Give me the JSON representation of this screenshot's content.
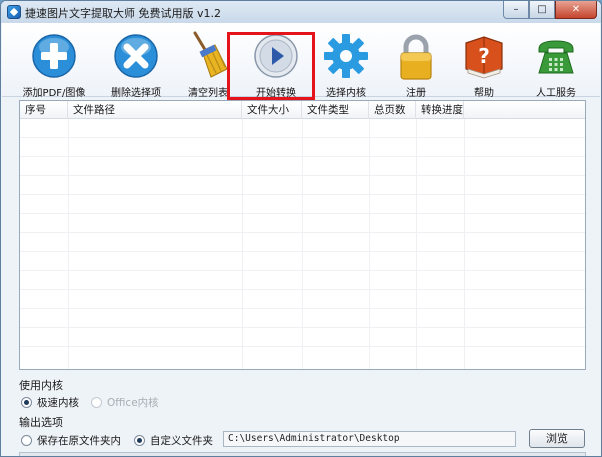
{
  "window": {
    "title": "捷速图片文字提取大师 免费试用版 v1.2",
    "minimize_glyph": "–",
    "maximize_glyph": "□",
    "close_glyph": "✕"
  },
  "toolbar": {
    "items": [
      {
        "label": "添加PDF/图像",
        "icon": "plus-circle-icon",
        "color": "#2a8fd8"
      },
      {
        "label": "删除选择项",
        "icon": "delete-x-icon",
        "color": "#2a8fd8"
      },
      {
        "label": "清空列表",
        "icon": "broom-icon",
        "color": "#e0a81c"
      },
      {
        "label": "开始转换",
        "icon": "play-icon",
        "color": "#2d5aa8"
      },
      {
        "label": "选择内核",
        "icon": "gear-icon",
        "color": "#2a9be0"
      },
      {
        "label": "注册",
        "icon": "lock-icon",
        "color": "#e8b020"
      },
      {
        "label": "帮助",
        "icon": "help-book-icon",
        "color": "#d8501c"
      },
      {
        "label": "人工服务",
        "icon": "phone-icon",
        "color": "#3a9a3a"
      }
    ]
  },
  "table": {
    "columns": [
      "序号",
      "文件路径",
      "文件大小",
      "文件类型",
      "总页数",
      "转换进度"
    ]
  },
  "engine": {
    "section_label": "使用内核",
    "options": [
      {
        "label": "极速内核",
        "selected": true,
        "enabled": true
      },
      {
        "label": "Office内核",
        "selected": false,
        "enabled": false
      }
    ]
  },
  "output": {
    "section_label": "输出选项",
    "options": [
      {
        "label": "保存在原文件夹内",
        "selected": false
      },
      {
        "label": "自定义文件夹",
        "selected": true
      }
    ],
    "path": "C:\\Users\\Administrator\\Desktop",
    "browse_label": "浏览"
  },
  "colors": {
    "highlight": "#e4141a"
  }
}
